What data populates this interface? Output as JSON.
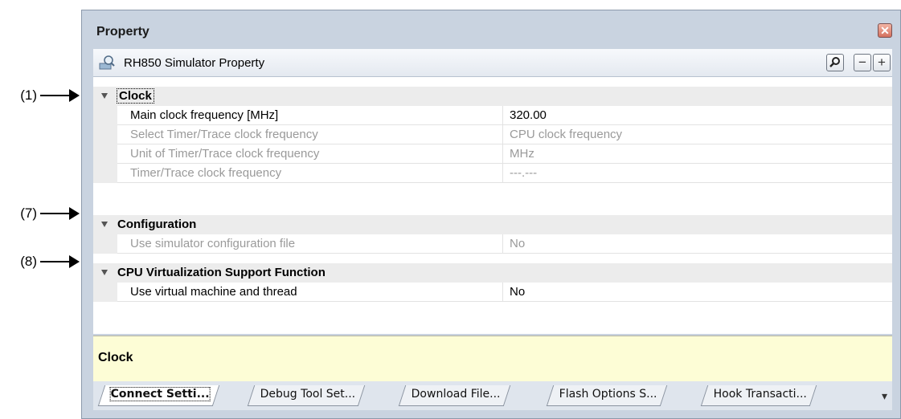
{
  "callouts": [
    "(1)",
    "(7)",
    "(8)"
  ],
  "panel": {
    "title": "Property",
    "subtitle": "RH850 Simulator Property"
  },
  "toolbar": {
    "search_icon": "search-icon",
    "collapse_label": "−",
    "expand_label": "+",
    "close_label": "✕"
  },
  "grid": {
    "categories": [
      {
        "name": "Clock",
        "properties": [
          {
            "name": "Main clock frequency [MHz]",
            "value": "320.00",
            "enabled": true
          },
          {
            "name": "Select Timer/Trace clock frequency",
            "value": "CPU clock frequency",
            "enabled": false
          },
          {
            "name": "Unit of Timer/Trace clock frequency",
            "value": "MHz",
            "enabled": false
          },
          {
            "name": "Timer/Trace clock frequency",
            "value": "---.---",
            "enabled": false
          }
        ]
      },
      {
        "name": "Configuration",
        "properties": [
          {
            "name": "Use simulator configuration file",
            "value": "No",
            "enabled": false
          }
        ]
      },
      {
        "name": "CPU Virtualization Support Function",
        "properties": [
          {
            "name": "Use virtual machine and thread",
            "value": "No",
            "enabled": true
          }
        ]
      }
    ]
  },
  "description": {
    "title": "Clock"
  },
  "tabs": [
    {
      "label": "Connect Setti...",
      "active": true
    },
    {
      "label": "Debug Tool Set...",
      "active": false
    },
    {
      "label": "Download File...",
      "active": false
    },
    {
      "label": "Flash Options S...",
      "active": false
    },
    {
      "label": "Hook Transacti...",
      "active": false
    }
  ],
  "tab_menu_label": "▾"
}
